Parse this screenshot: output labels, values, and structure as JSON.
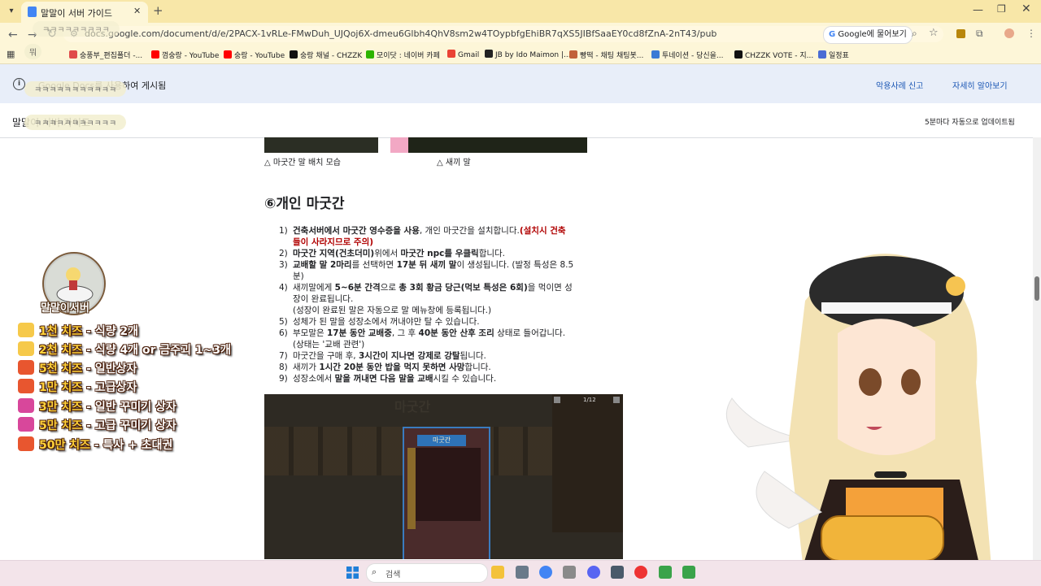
{
  "browser": {
    "tab_title": "말말이 서버 가이드",
    "new_tab": "+",
    "url": "docs.google.com/document/d/e/2PACX-1vRLe-FMwDuh_UJQoj6X-dmeu6Glbh4QhV8sm2w4TOypbfgEhiBR7qXS5JIBfSaaEY0cd8fZnA-2nT43/pub",
    "ask_google": "Google에 물어보기",
    "bookmarks": [
      "숭풍부_편집폴더 -...",
      "껌숭랑 - YouTube",
      "숭랑 - YouTube",
      "숭랑 채널 - CHZZK",
      "모이닷 : 네이버 카페",
      "Gmail",
      "JB by Ido Maimon |...",
      "빵떡 - 채팅 채팅봇...",
      "투네이션 - 당신을...",
      "CHZZK VOTE - 지...",
      "일정표"
    ]
  },
  "banner": {
    "text": "Google Docs를 사용하여 게시됨",
    "report_link": "악용사례 신고",
    "learn_link": "자세히 알아보기"
  },
  "doc": {
    "title": "말말이 서버 가이드",
    "auto_update": "5분마다 자동으로 업데이트됨",
    "caption_left": "△ 마굿간 말 배치 모습",
    "caption_right": "△ 새끼 말",
    "section_heading": "⑥개인 마굿간",
    "items": [
      {
        "n": "1)",
        "parts": [
          [
            "b",
            "건축서버에서 마굿간 영수증을 사용"
          ],
          [
            "t",
            ", 개인 마굿간을 설치합니다."
          ],
          [
            "r",
            "(설치시 건축"
          ]
        ],
        "cont": [
          [
            "r",
            "들이 사라지므로 주의)"
          ]
        ]
      },
      {
        "n": "2)",
        "parts": [
          [
            "b",
            "마굿간 지역(건초더미)"
          ],
          [
            "t",
            "위에서 "
          ],
          [
            "b",
            "마굿간 npc를 우클릭"
          ],
          [
            "t",
            "합니다."
          ]
        ]
      },
      {
        "n": "3)",
        "parts": [
          [
            "b",
            "교배할 말 2마리"
          ],
          [
            "t",
            "를 선택하면 "
          ],
          [
            "b",
            "17분 뒤 새끼 말"
          ],
          [
            "t",
            "이 생성됩니다. (발정 특성은 8.5"
          ]
        ],
        "cont": [
          [
            "t",
            "분)"
          ]
        ]
      },
      {
        "n": "4)",
        "parts": [
          [
            "t",
            "새끼말에게 "
          ],
          [
            "b",
            "5~6분 간격"
          ],
          [
            "t",
            "으로 "
          ],
          [
            "b",
            "총 3회 황금 당근(먹보 특성은 6회)"
          ],
          [
            "t",
            "을 먹이면 성"
          ]
        ],
        "cont": [
          [
            "t",
            "장이 완료됩니다."
          ]
        ],
        "cont2": [
          [
            "t",
            "(성장이 완료된 말은 자동으로 말 메뉴창에 등록됩니다.)"
          ]
        ]
      },
      {
        "n": "5)",
        "parts": [
          [
            "t",
            "성체가 된 말을 성장소에서 꺼내야만 탈 수 있습니다."
          ]
        ]
      },
      {
        "n": "6)",
        "parts": [
          [
            "t",
            "부모말은 "
          ],
          [
            "b",
            "17분 동안 교배중"
          ],
          [
            "t",
            ", 그 후 "
          ],
          [
            "b",
            "40분 동안 산후 조리"
          ],
          [
            "t",
            " 상태로 들어갑니다."
          ]
        ],
        "cont": [
          [
            "t",
            "(상태는 '교배 관련')"
          ]
        ]
      },
      {
        "n": "7)",
        "parts": [
          [
            "t",
            "마굿간을 구매 후, "
          ],
          [
            "b",
            "3시간이 지나면 강제로 강탈"
          ],
          [
            "t",
            "됩니다."
          ]
        ]
      },
      {
        "n": "8)",
        "parts": [
          [
            "t",
            "새끼가 "
          ],
          [
            "b",
            "1시간 20분 동안 밥을 먹지 못하면 사망"
          ],
          [
            "t",
            "합니다."
          ]
        ]
      },
      {
        "n": "9)",
        "parts": [
          [
            "t",
            "성장소에서 "
          ],
          [
            "b",
            "말을 꺼내면 다음 말을 교배"
          ],
          [
            "t",
            "시킬 수 있습니다."
          ]
        ]
      }
    ],
    "game_title": "마굿간",
    "game_pager": "1/12"
  },
  "overlay": {
    "server_name": "말말이서버",
    "tiers": [
      {
        "k": "1천 치즈",
        "v": " - 식량 2개"
      },
      {
        "k": "2천 치즈",
        "v": " - 식량 4개 or 금주괴 1~3개"
      },
      {
        "k": "5천 치즈",
        "v": " - 일반상자"
      },
      {
        "k": "1만 치즈",
        "v": " - 고급상자"
      },
      {
        "k": "3만 치즈",
        "v": " - 일반 꾸미기 상자"
      },
      {
        "k": "5만 치즈",
        "v": " - 고급 꾸미기 상자"
      },
      {
        "k": "50만 치즈",
        "v": " - 특사 + 초대권"
      }
    ],
    "chat": [
      "ㅋㅋㅋㅋㅋㅋㅋㅋㅋㅋㅋ",
      "ㅋㅋㅋㅋㅋㅋㅋㅋㅋㅋㅋ",
      "ㅋㅋㅋㅋㅋㅋㅋㅋㅋ"
    ],
    "chat_small": "뭐"
  },
  "taskbar": {
    "search": "검색"
  },
  "colors": {
    "tab_strip": "#f8e7a8",
    "banner_bg": "#e8eef9",
    "warning_red": "#b00000",
    "link_blue": "#1a56b4",
    "cheese_yellow": "#ffd23a"
  }
}
